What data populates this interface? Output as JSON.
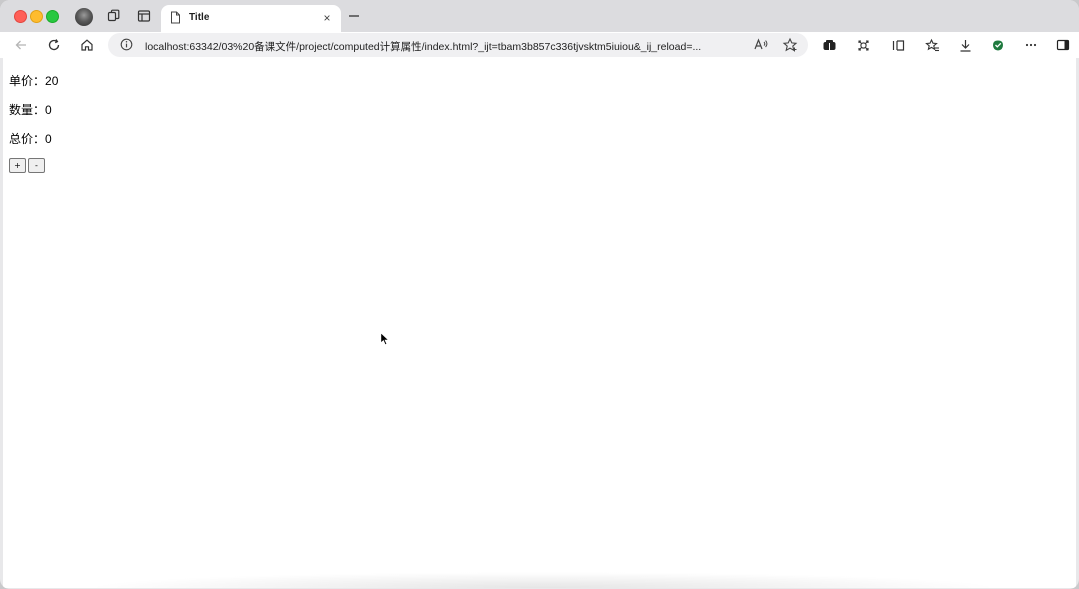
{
  "browser": {
    "tab": {
      "title": "Title",
      "close_glyph": "×"
    },
    "new_tab_glyph": "—",
    "address": {
      "url": "localhost:63342/03%20备课文件/project/computed计算属性/index.html?_ijt=tbam3b857c336tjvsktm5iuiou&_ij_reload=..."
    },
    "toolbar_icons": [
      "back-icon",
      "refresh-icon",
      "home-icon",
      "info-icon",
      "read-aloud-icon",
      "favorite-star-icon",
      "extensions-icon",
      "sync-icon",
      "split-screen-icon",
      "favorites-icon",
      "downloads-icon",
      "browser-essentials-icon",
      "more-icon",
      "sidebar-icon"
    ]
  },
  "page": {
    "price": {
      "label": "单价：",
      "value": "20"
    },
    "quantity": {
      "label": "数量：",
      "value": "0"
    },
    "total": {
      "label": "总价：",
      "value": "0"
    },
    "buttons": {
      "increment_label": "+",
      "decrement_label": "-"
    }
  },
  "colors": {
    "traffic_red": "#ff5f57",
    "traffic_yellow": "#febc2e",
    "traffic_green": "#28c840",
    "tabstrip_bg": "#dcdcdf",
    "urlbar_bg": "#f0f0f2"
  }
}
